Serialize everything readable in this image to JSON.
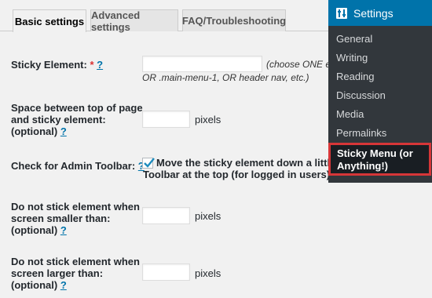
{
  "tabs": [
    {
      "label": "Basic settings"
    },
    {
      "label": "Advanced settings"
    },
    {
      "label": "FAQ/Troubleshooting"
    }
  ],
  "form": {
    "sticky_element": {
      "label": "Sticky Element:",
      "required_mark": "*",
      "help": "?",
      "value": "",
      "note_line1": "(choose ONE ele",
      "note_line2": "OR .main-menu-1, OR header nav, etc.)"
    },
    "space_top": {
      "label_line1": "Space between top of page",
      "label_line2": "and sticky element:",
      "label_line3": "(optional)",
      "help": "?",
      "value": "",
      "unit": "pixels"
    },
    "admin_toolbar": {
      "label": "Check for Admin Toolbar:",
      "help": "?",
      "checked": true,
      "text_line1": "Move the sticky element down a little if th",
      "text_line2": "Toolbar at the top (for logged in users)."
    },
    "min_width": {
      "label_line1": "Do not stick element when",
      "label_line2": "screen smaller than:",
      "label_line3": "(optional)",
      "help": "?",
      "value": "",
      "unit": "pixels"
    },
    "max_width": {
      "label_line1": "Do not stick element when",
      "label_line2": "screen larger than:",
      "label_line3": "(optional)",
      "help": "?",
      "value": "",
      "unit": "pixels"
    }
  },
  "admin_menu": {
    "title": "Settings",
    "icon": "wordpress-settings-icon",
    "items": [
      {
        "label": "General"
      },
      {
        "label": "Writing"
      },
      {
        "label": "Reading"
      },
      {
        "label": "Discussion"
      },
      {
        "label": "Media"
      },
      {
        "label": "Permalinks"
      }
    ],
    "highlighted": {
      "label_line1": "Sticky Menu (or",
      "label_line2": "Anything!)"
    }
  },
  "colors": {
    "accent": "#0073aa",
    "menu_bg": "#32373c",
    "highlight_border": "#d63638",
    "required": "#dc3232"
  }
}
